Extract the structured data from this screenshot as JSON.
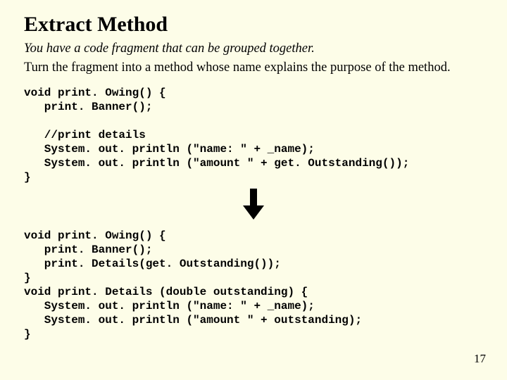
{
  "slide": {
    "title": "Extract Method",
    "problem": "You have a code fragment that can be grouped together.",
    "solution": "Turn the fragment into a method whose name explains the purpose of the method.",
    "code_before": "void print. Owing() {\n   print. Banner();\n\n   //print details\n   System. out. println (\"name: \" + _name);\n   System. out. println (\"amount \" + get. Outstanding());\n}",
    "code_after": "void print. Owing() {\n   print. Banner();\n   print. Details(get. Outstanding());\n}\nvoid print. Details (double outstanding) {\n   System. out. println (\"name: \" + _name);\n   System. out. println (\"amount \" + outstanding);\n}",
    "page_number": "17"
  }
}
